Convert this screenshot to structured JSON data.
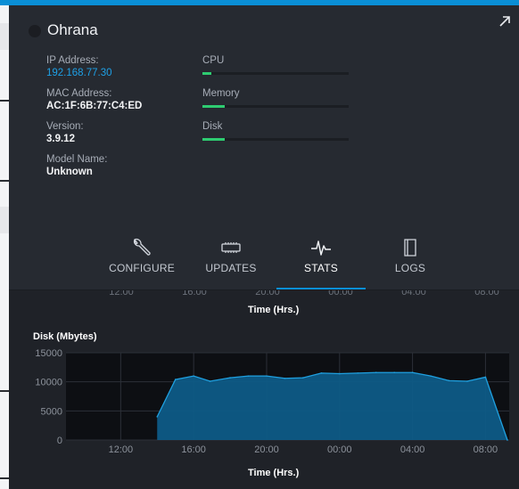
{
  "device": {
    "name": "Ohrana",
    "ip_label": "IP Address:",
    "ip": "192.168.77.30",
    "mac_label": "MAC Address:",
    "mac": "AC:1F:6B:77:C4:ED",
    "version_label": "Version:",
    "version": "3.9.12",
    "model_label": "Model Name:",
    "model": "Unknown"
  },
  "resources": [
    {
      "label": "CPU",
      "fraction": 0.06
    },
    {
      "label": "Memory",
      "fraction": 0.15
    },
    {
      "label": "Disk",
      "fraction": 0.15
    }
  ],
  "tabs": [
    {
      "label": "CONFIGURE",
      "icon": "wrench-icon"
    },
    {
      "label": "UPDATES",
      "icon": "chip-icon"
    },
    {
      "label": "STATS",
      "icon": "pulse-icon",
      "active": true
    },
    {
      "label": "LOGS",
      "icon": "document-icon"
    }
  ],
  "prev_chart": {
    "xlabel": "Time (Hrs.)",
    "tick_labels": [
      "12:00",
      "16:00",
      "20:00",
      "00:00",
      "04:00",
      "08:00"
    ]
  },
  "colors": {
    "accent": "#0a8fd6",
    "meter_fill": "#2ecc71",
    "link": "#1ea0e6",
    "area_fill": "#0e5b86",
    "area_line": "#1fa0e0"
  },
  "chart_data": {
    "type": "area",
    "title": "Disk (Mbytes)",
    "xlabel": "Time (Hrs.)",
    "ylabel": "",
    "x_ticks": [
      "12:00",
      "16:00",
      "20:00",
      "00:00",
      "04:00",
      "08:00"
    ],
    "y_ticks": [
      0,
      5000,
      10000,
      15000
    ],
    "ylim": [
      0,
      15000
    ],
    "x_hours_range": [
      9,
      33.3
    ],
    "grid": true,
    "series": [
      {
        "x": [
          14.0,
          15.0,
          16.0,
          16.9,
          18.0,
          19.0,
          20.0,
          21.0,
          22.0,
          23.0,
          24.0,
          25.0,
          26.0,
          27.0,
          28.0,
          29.0,
          30.0,
          31.0,
          32.0,
          33.2
        ],
        "values": [
          4000,
          10400,
          11000,
          10100,
          10700,
          11000,
          11000,
          10600,
          10700,
          11500,
          11400,
          11500,
          11600,
          11600,
          11600,
          11000,
          10200,
          10100,
          10800,
          0
        ]
      }
    ]
  }
}
